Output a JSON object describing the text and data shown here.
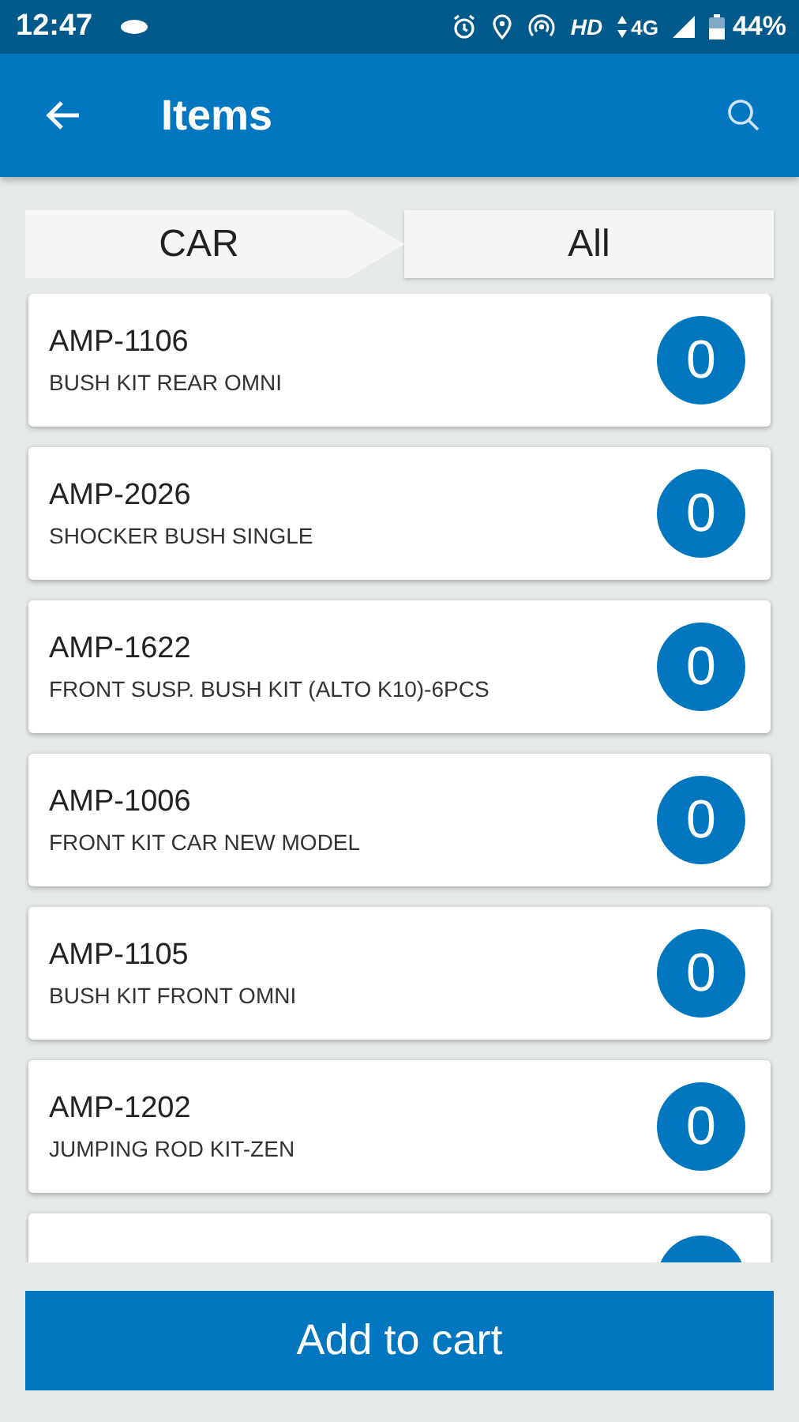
{
  "status_bar": {
    "time": "12:47",
    "network": "HD",
    "data": "4G",
    "battery": "44%"
  },
  "app_bar": {
    "title": "Items"
  },
  "breadcrumb": [
    "CAR",
    "All"
  ],
  "items": [
    {
      "code": "AMP-1106",
      "name": "BUSH KIT REAR OMNI",
      "count": "0"
    },
    {
      "code": "AMP-2026",
      "name": "SHOCKER BUSH SINGLE",
      "count": "0"
    },
    {
      "code": "AMP-1622",
      "name": "FRONT SUSP. BUSH KIT (ALTO K10)-6PCS",
      "count": "0"
    },
    {
      "code": "AMP-1006",
      "name": "FRONT KIT CAR NEW MODEL",
      "count": "0"
    },
    {
      "code": "AMP-1105",
      "name": "BUSH KIT FRONT OMNI",
      "count": "0"
    },
    {
      "code": "AMP-1202",
      "name": "JUMPING ROD KIT-ZEN",
      "count": "0"
    }
  ],
  "button": "Add to cart"
}
